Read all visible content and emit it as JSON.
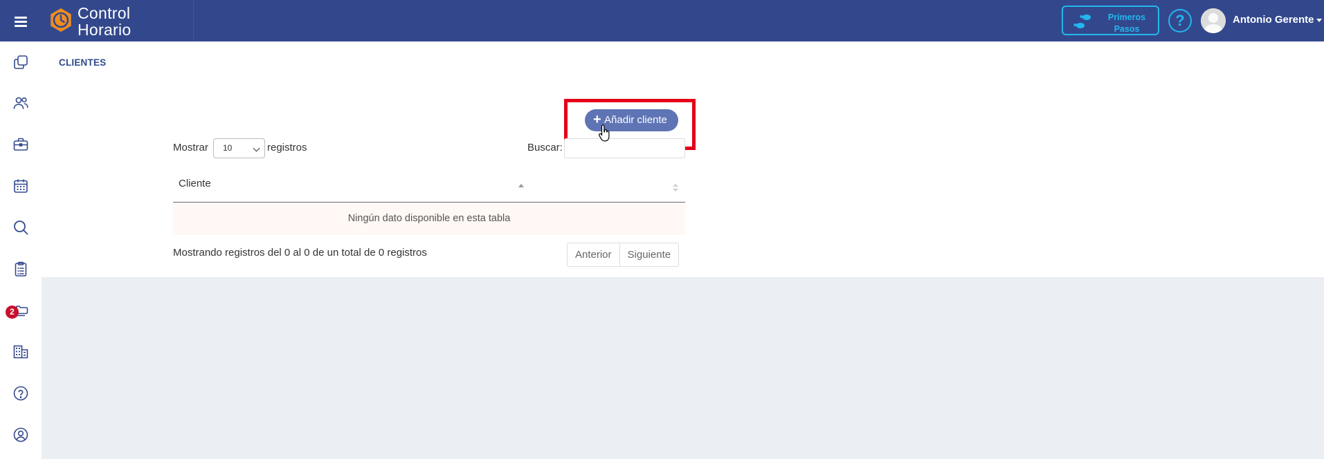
{
  "app": {
    "brand_line1": "Control",
    "brand_line2": "Horario"
  },
  "topbar": {
    "primeros_line1": "Primeros",
    "primeros_line2": "Pasos",
    "help_glyph": "?",
    "user_name": "Antonio Gerente"
  },
  "sidebar": {
    "items": [
      {
        "icon": "copy-icon"
      },
      {
        "icon": "users-icon"
      },
      {
        "icon": "briefcase-icon"
      },
      {
        "icon": "calendar-icon"
      },
      {
        "icon": "search-icon"
      },
      {
        "icon": "clipboard-icon"
      },
      {
        "icon": "folder-icon",
        "badge": "2"
      },
      {
        "icon": "building-icon"
      },
      {
        "icon": "help-icon"
      },
      {
        "icon": "account-icon"
      }
    ]
  },
  "page": {
    "title": "CLIENTES",
    "add_button": "Añadir cliente",
    "show_label": "Mostrar",
    "page_length": "10",
    "records_label": "registros",
    "search_label": "Buscar:",
    "search_value": "",
    "column_header": "Cliente",
    "empty_message": "Ningún dato disponible en esta tabla",
    "info": "Mostrando registros del 0 al 0 de un total de 0 registros",
    "prev_button": "Anterior",
    "next_button": "Siguiente"
  },
  "colors": {
    "topbar": "#33488c",
    "accent": "#22b7f0",
    "button": "#5f74b4",
    "highlight": "#e5001a",
    "badge": "#c8102e"
  }
}
